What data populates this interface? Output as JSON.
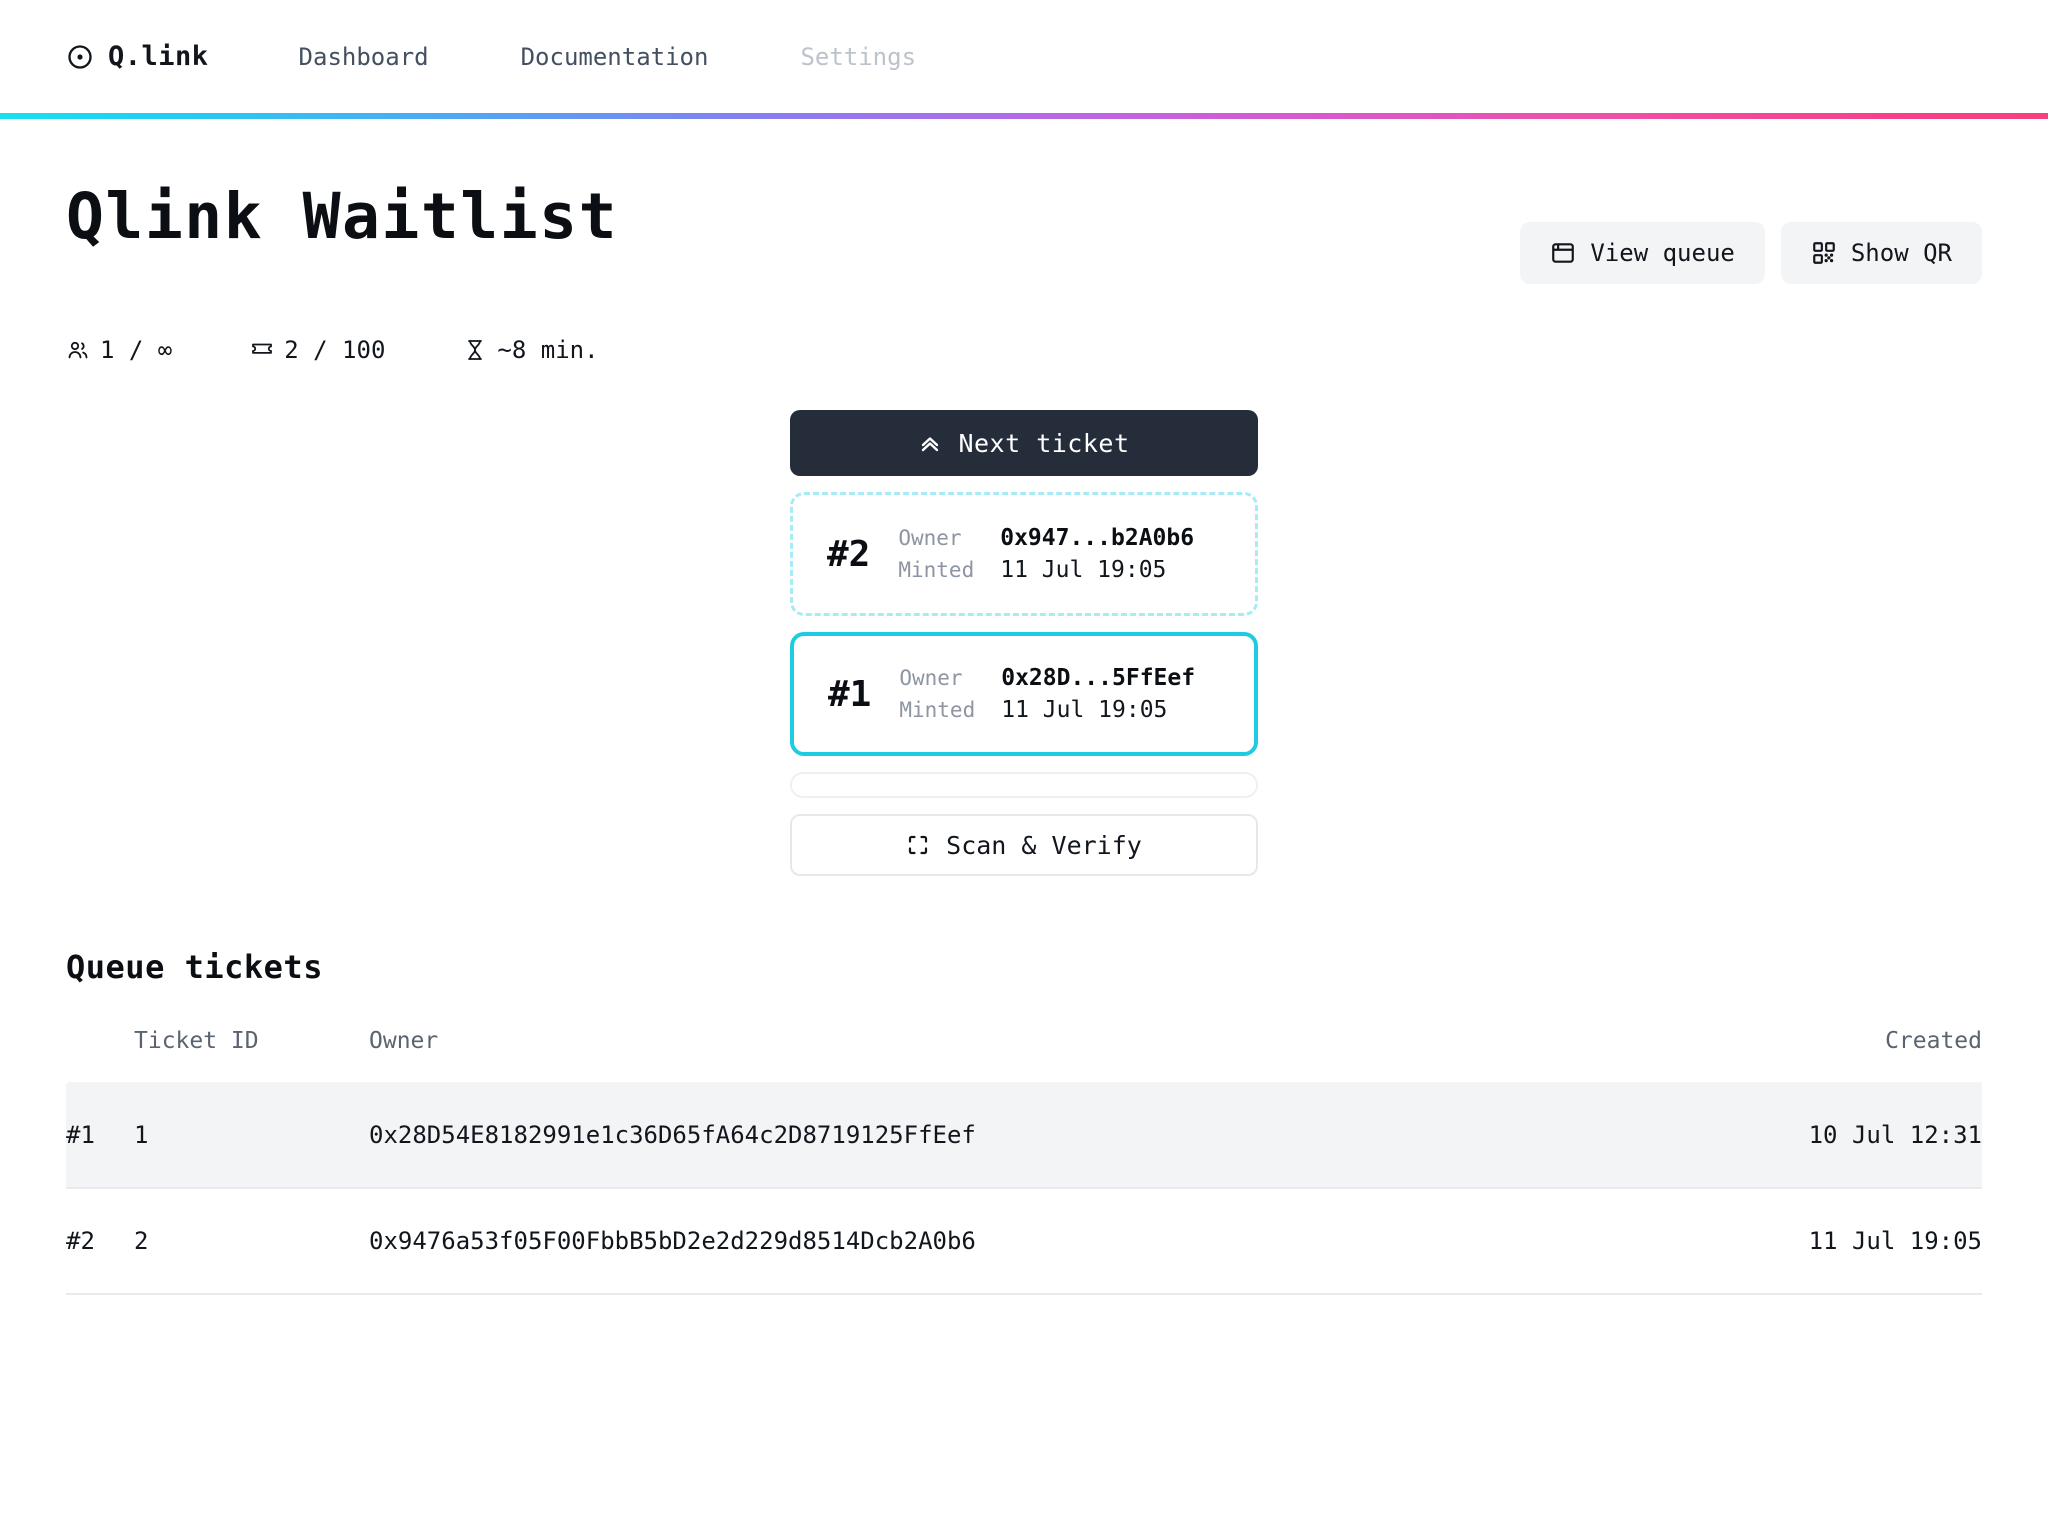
{
  "nav": {
    "brand": "Q.link",
    "brand_icon": "circle-dot-icon",
    "links": [
      {
        "label": "Dashboard",
        "state": "default"
      },
      {
        "label": "Documentation",
        "state": "default"
      },
      {
        "label": "Settings",
        "state": "muted"
      }
    ],
    "gradient": {
      "from": "#17e0ef",
      "mid": "#b36ae8",
      "to": "#f53f7e"
    }
  },
  "header": {
    "title": "Qlink Waitlist",
    "actions": [
      {
        "label": "View queue",
        "icon": "window-icon"
      },
      {
        "label": "Show QR",
        "icon": "qr-code-icon"
      }
    ]
  },
  "stats": [
    {
      "icon": "users-icon",
      "value": "1 / ∞"
    },
    {
      "icon": "ticket-icon",
      "value": "2 / 100"
    },
    {
      "icon": "hourglass-icon",
      "value": "~8 min."
    }
  ],
  "console": {
    "next_ticket_label": "Next ticket",
    "next_ticket_icon": "chevrons-up-icon",
    "scan_label": "Scan & Verify",
    "scan_icon": "scan-icon",
    "cards": [
      {
        "number": "#2",
        "state": "pending",
        "owner_label": "Owner",
        "owner_value": "0x947...b2A0b6",
        "minted_label": "Minted",
        "minted_value": "11 Jul 19:05"
      },
      {
        "number": "#1",
        "state": "active",
        "owner_label": "Owner",
        "owner_value": "0x28D...5FfEef",
        "minted_label": "Minted",
        "minted_value": "11 Jul 19:05"
      }
    ],
    "progress_value": ""
  },
  "queue": {
    "section_title": "Queue tickets",
    "columns": [
      "",
      "Ticket ID",
      "Owner",
      "Created"
    ],
    "rows": [
      {
        "rank": "#1",
        "ticket_id": "1",
        "owner": "0x28D54E8182991e1c36D65fA64c2D8719125FfEef",
        "created": "10 Jul 12:31",
        "highlight": true
      },
      {
        "rank": "#2",
        "ticket_id": "2",
        "owner": "0x9476a53f05F00FbbB5bD2e2d229d8514Dcb2A0b6",
        "created": "11 Jul 19:05",
        "highlight": false
      }
    ]
  }
}
